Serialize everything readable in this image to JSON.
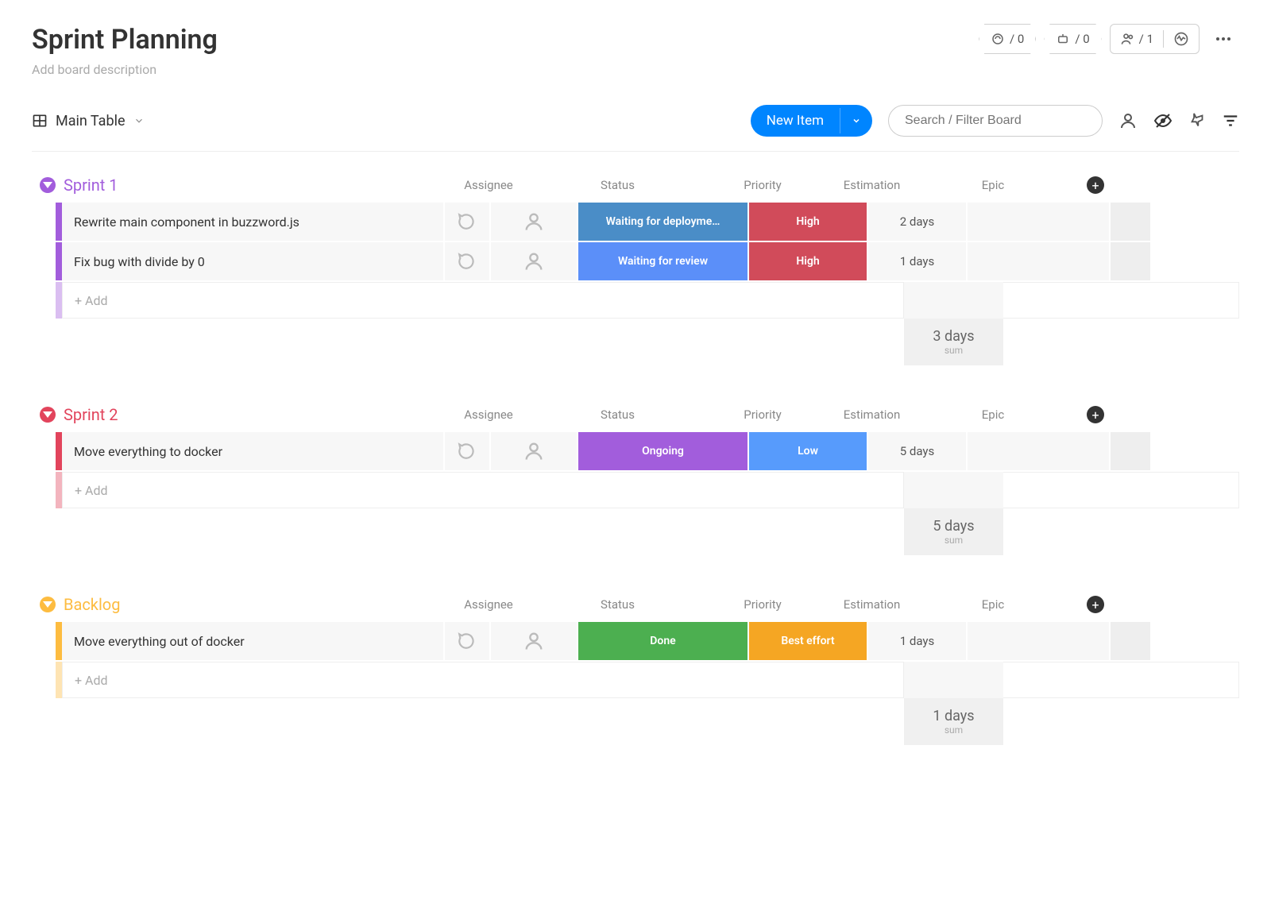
{
  "header": {
    "title": "Sprint Planning",
    "description": "Add board description",
    "stats": {
      "plugin_count": "/ 0",
      "bot_count": "/ 0",
      "members_count": "/ 1"
    }
  },
  "subheader": {
    "view_name": "Main Table",
    "new_item_label": "New Item",
    "search_placeholder": "Search / Filter Board"
  },
  "column_labels": {
    "assignee": "Assignee",
    "status": "Status",
    "priority": "Priority",
    "estimation": "Estimation",
    "epic": "Epic"
  },
  "add_row_label": "+ Add",
  "summary_label": "sum",
  "groups": [
    {
      "name": "Sprint 1",
      "color": "#a25ddc",
      "items": [
        {
          "name": "Rewrite main component in buzzword.js",
          "status": "Waiting for deployme…",
          "status_color": "#4a8dc7",
          "priority": "High",
          "priority_color": "#d14b5a",
          "estimation": "2 days"
        },
        {
          "name": "Fix bug with divide by 0",
          "status": "Waiting for review",
          "status_color": "#5b8ff9",
          "priority": "High",
          "priority_color": "#d14b5a",
          "estimation": "1 days"
        }
      ],
      "sum": "3 days"
    },
    {
      "name": "Sprint 2",
      "color": "#e2445c",
      "items": [
        {
          "name": "Move everything to docker",
          "status": "Ongoing",
          "status_color": "#a25ddc",
          "priority": "Low",
          "priority_color": "#579bfc",
          "estimation": "5 days"
        }
      ],
      "sum": "5 days"
    },
    {
      "name": "Backlog",
      "color": "#fdbc40",
      "items": [
        {
          "name": "Move everything out of docker",
          "status": "Done",
          "status_color": "#4caf50",
          "priority": "Best effort",
          "priority_color": "#f5a623",
          "estimation": "1 days"
        }
      ],
      "sum": "1 days"
    }
  ]
}
